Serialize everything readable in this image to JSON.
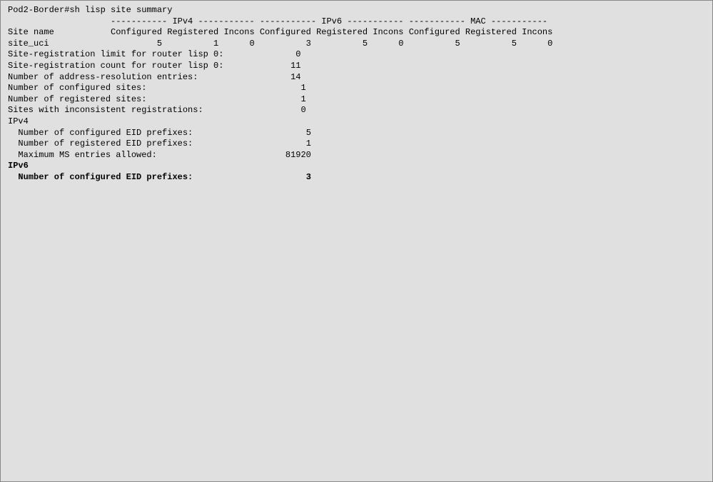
{
  "prompt_line": "Pod2-Border#sh lisp site summary",
  "header_line": "                    ----------- IPv4 ----------- ----------- IPv6 ----------- ----------- MAC -----------",
  "columns_line": "Site name           Configured Registered Incons Configured Registered Incons Configured Registered Incons",
  "site": {
    "name": "site_uci",
    "ipv4_configured": "5",
    "ipv4_registered": "1",
    "ipv4_incons": "0",
    "ipv6_configured": "3",
    "ipv6_registered": "5",
    "ipv6_incons": "0",
    "mac_configured": "5",
    "mac_registered": "5",
    "mac_incons": "0"
  },
  "site_row_text": "site_uci                     5          1      0          3          5      0          5          5      0",
  "stats": {
    "reg_limit_label": "Site-registration limit for router lisp 0:",
    "reg_limit_value": "0",
    "reg_count_label": "Site-registration count for router lisp 0:",
    "reg_count_value": "11",
    "addr_res_label": "Number of address-resolution entries:",
    "addr_res_value": "14",
    "conf_sites_label": "Number of configured sites:",
    "conf_sites_value": "1",
    "reg_sites_label": "Number of registered sites:",
    "reg_sites_value": "1",
    "incons_label": "Sites with inconsistent registrations:",
    "incons_value": "0"
  },
  "ipv4_section": {
    "heading": "IPv4",
    "conf_prefixes_label": "  Number of configured EID prefixes:",
    "conf_prefixes_value": "5",
    "reg_prefixes_label": "  Number of registered EID prefixes:",
    "reg_prefixes_value": "1",
    "max_ms_label": "  Maximum MS entries allowed:",
    "max_ms_value": "81920"
  },
  "ipv6_section": {
    "heading": "IPv6",
    "conf_prefixes_label": "  Number of configured EID prefixes:",
    "conf_prefixes_value": "3"
  }
}
